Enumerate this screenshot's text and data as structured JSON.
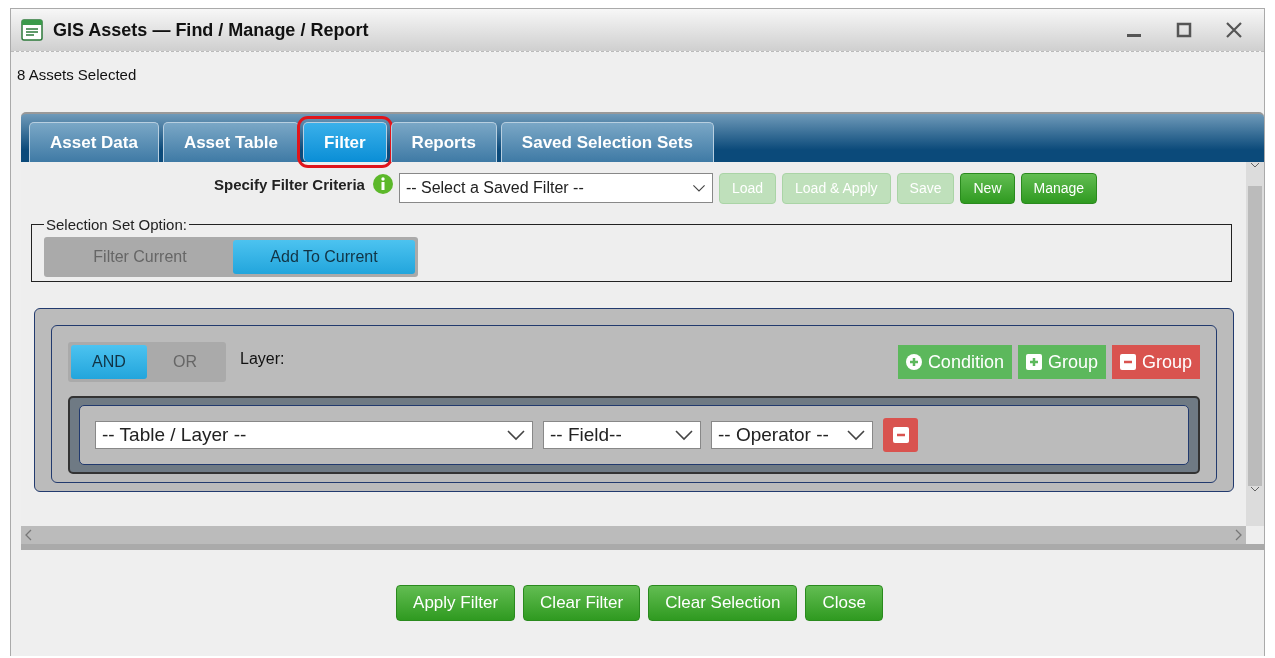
{
  "window": {
    "title": "GIS Assets — Find / Manage / Report"
  },
  "selection_status": "8 Assets Selected",
  "tabs": [
    {
      "label": "Asset Data",
      "selected": false,
      "highlighted": false
    },
    {
      "label": "Asset Table",
      "selected": false,
      "highlighted": false
    },
    {
      "label": "Filter",
      "selected": true,
      "highlighted": true
    },
    {
      "label": "Reports",
      "selected": false,
      "highlighted": false
    },
    {
      "label": "Saved Selection Sets",
      "selected": false,
      "highlighted": false
    }
  ],
  "filter": {
    "label": "Specify Filter Criteria",
    "saved_filter": {
      "value": "-- Select a Saved Filter --"
    },
    "buttons": [
      {
        "label": "Load",
        "disabled": true
      },
      {
        "label": "Load & Apply",
        "disabled": true
      },
      {
        "label": "Save",
        "disabled": true
      },
      {
        "label": "New",
        "disabled": false
      },
      {
        "label": "Manage",
        "disabled": false
      }
    ]
  },
  "selection_set_option": {
    "legend": "Selection Set Option:",
    "options": [
      {
        "label": "Filter Current",
        "selected": false
      },
      {
        "label": "Add To Current",
        "selected": true
      }
    ]
  },
  "group": {
    "logic": [
      {
        "label": "AND",
        "selected": true
      },
      {
        "label": "OR",
        "selected": false
      }
    ],
    "layer_label": "Layer:",
    "actions": [
      {
        "kind": "add-condition",
        "label": "Condition"
      },
      {
        "kind": "add-group",
        "label": "Group"
      },
      {
        "kind": "remove-group",
        "label": "Group"
      }
    ],
    "conditions": [
      {
        "table": "-- Table / Layer --",
        "field": "-- Field--",
        "operator": "-- Operator --"
      }
    ]
  },
  "footer_buttons": [
    "Apply Filter",
    "Clear Filter",
    "Clear Selection",
    "Close"
  ]
}
